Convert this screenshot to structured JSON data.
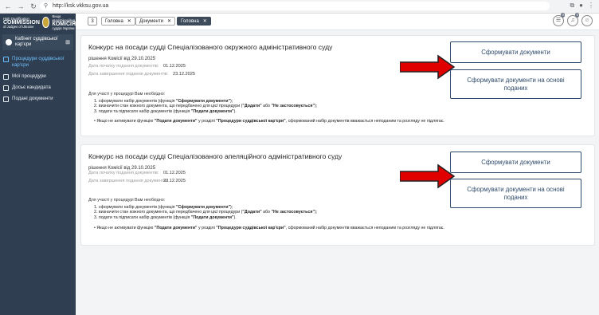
{
  "browser": {
    "url": "http://ksk.vkksu.gov.ua"
  },
  "sidebar": {
    "logo_lines": [
      "High Qualification",
      "COMMISSION",
      "of Judges of Ukraine"
    ],
    "logo_ua_small": "Вища кваліфікаційна",
    "logo_ua_big": "КОМІСІЯ",
    "logo_ua_bottom": "суддів України",
    "cabinet_label": "Кабінет суддівської кар'єри",
    "items": [
      {
        "label": "Процедури суддівської кар'єри",
        "active": true
      },
      {
        "label": "Мої процедури",
        "active": false
      },
      {
        "label": "Досьє кандидата",
        "active": false
      },
      {
        "label": "Подані документи",
        "active": false
      }
    ]
  },
  "tabs": {
    "count": "3",
    "items": [
      {
        "label": "Головна",
        "active": false
      },
      {
        "label": "Документи",
        "active": false
      },
      {
        "label": "Головна",
        "active": true
      }
    ],
    "close_glyph": "✕"
  },
  "header": {
    "badge_1": "0",
    "badge_2": "0"
  },
  "cards": [
    {
      "title": "Конкурс на посади судді Спеціалізованого окружного адміністративного суду",
      "decision": "рішення Комісії від 29.10.2025",
      "start_label": "Дата початку подання документів:",
      "start_value": "01.12.2025",
      "end_label": "Дата завершення подання документів:",
      "end_value": "23.12.2025",
      "instructions_intro": "Для участі у процедурі Вам необхідно:",
      "steps": [
        "сформувати набір документів (функція \"Сформувати документи\");",
        "визначити стан кожного документа, що передбачено для цієї процедури (\"Додати\" або \"Не застосовується\");",
        "подати та підписати набір документів (функція \"Подати документи\")."
      ],
      "note": "Якщо не активувати функцію \"Подати документи\" у розділі \"Процедури суддівської кар'єри\", сформований набір документів вважається неподаним та розгляду не підлягає.",
      "button_generate": "Сформувати документи",
      "button_generate_based": "Сформувати документи на основі поданих"
    },
    {
      "title": "Конкурс на посади судді Спеціалізованого апеляційного адміністративного суду",
      "decision": "рішення Комісії від 29.10.2025",
      "start_label": "Дата початку подання документів:",
      "start_value": "01.12.2025",
      "end_label": "Дата завершення подання документів:",
      "end_value": "23.12.2025",
      "instructions_intro": "Для участі у процедурі Вам необхідно:",
      "steps": [
        "сформувати набір документів (функція \"Сформувати документи\");",
        "визначити стан кожного документа, що передбачено для цієї процедури (\"Додати\" або \"Не застосовується\");",
        "подати та підписати набір документів (функція \"Подати документи\")."
      ],
      "note": "Якщо не активувати функцію \"Подати документи\" у розділі \"Процедури суддівської кар'єри\", сформований набір документів вважається неподаним та розгляду не підлягає.",
      "button_generate": "Сформувати документи",
      "button_generate_based": "Сформувати документи на основі поданих"
    }
  ],
  "colors": {
    "sidebar_bg": "#2f3e50",
    "active_link": "#6fc1ff",
    "button_border": "#2e4a6b",
    "arrow_red": "#e00000"
  }
}
